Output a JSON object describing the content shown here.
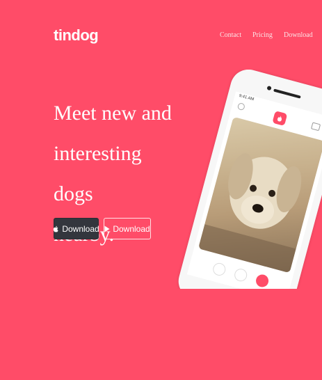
{
  "navbar": {
    "brand": "tindog",
    "links": [
      "Contact",
      "Pricing",
      "Download"
    ]
  },
  "hero": {
    "headline_lines": [
      "Meet new and",
      "interesting dogs",
      "nearby."
    ],
    "buttons": [
      {
        "label": "Download",
        "icon": "apple-icon",
        "style": "dark"
      },
      {
        "label": "Download",
        "icon": "google-play-icon",
        "style": "outline"
      }
    ]
  },
  "phone": {
    "status_time": "9:41 AM"
  },
  "colors": {
    "background": "#ff4c68",
    "dark_button": "#33363d",
    "text": "#ffffff"
  }
}
